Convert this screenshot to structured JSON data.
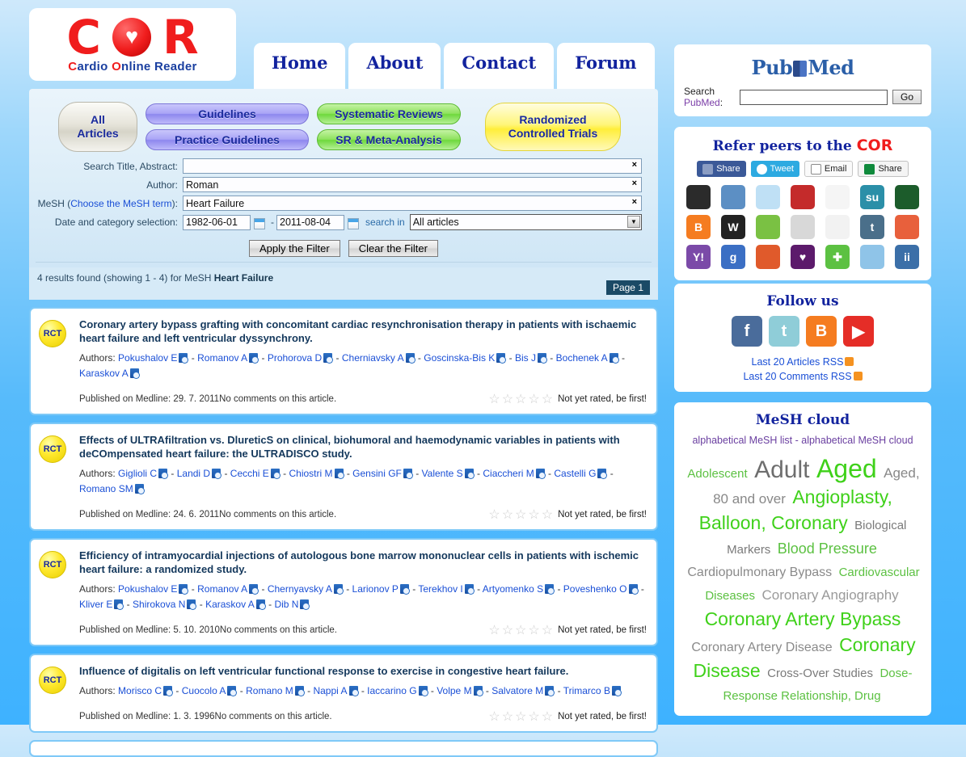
{
  "site": {
    "logo_c": "C",
    "logo_heart": "♥",
    "logo_r": "R",
    "tagline_pre": "C",
    "tagline": "ardio ",
    "tagline_o": "O",
    "tagline_2": "nline Reader"
  },
  "nav": {
    "tabs": [
      {
        "label": "Home",
        "active": true
      },
      {
        "label": "About",
        "active": false
      },
      {
        "label": "Contact",
        "active": false
      },
      {
        "label": "Forum",
        "active": false
      }
    ]
  },
  "categories": {
    "all_articles": "All\nArticles",
    "all_line1": "All",
    "all_line2": "Articles",
    "guidelines": "Guidelines",
    "practice_guidelines": "Practice Guidelines",
    "systematic_reviews": "Systematic Reviews",
    "sr_meta": "SR & Meta-Analysis",
    "rct_line1": "Randomized",
    "rct_line2": "Controlled Trials"
  },
  "filter": {
    "label_title": "Search Title, Abstract:",
    "value_title": "",
    "label_author": "Author:",
    "value_author": "Roman",
    "label_mesh_pre": "MeSH (",
    "label_mesh_link": "Choose the MeSH term",
    "label_mesh_post": "):",
    "value_mesh": "Heart Failure",
    "label_date": "Date and category selection:",
    "date_from": "1982-06-01",
    "date_to": "2011-08-04",
    "dash": "-",
    "search_in_label": "search in",
    "category_selected": "All articles",
    "apply_button": "Apply the Filter",
    "clear_button": "Clear the Filter",
    "clear_x": "×"
  },
  "results": {
    "summary_pre": "4 results found (showing 1 - 4) for MeSH ",
    "summary_term": "Heart Failure",
    "page_badge": "Page 1"
  },
  "articles": [
    {
      "badge": "RCT",
      "title": "Coronary artery bypass grafting with concomitant cardiac resynchronisation therapy in patients with ischaemic heart failure and left ventricular dyssynchrony.",
      "authors_label": "Authors:",
      "authors": [
        "Pokushalov E",
        "Romanov A",
        "Prohorova D",
        "Cherniavsky A",
        "Goscinska-Bis K",
        "Bis J",
        "Bochenek A",
        "Karaskov A"
      ],
      "published": "Published on Medline: 29. 7. 2011",
      "comments": "No comments on this article.",
      "rating_text": "Not yet rated, be first!",
      "stars": 0
    },
    {
      "badge": "RCT",
      "title": "Effects of ULTRAfiltration vs. DlureticS on clinical, biohumoral and haemodynamic variables in patients with deCOmpensated heart failure: the ULTRADISCO study.",
      "authors_label": "Authors:",
      "authors": [
        "Giglioli C",
        "Landi D",
        "Cecchi E",
        "Chiostri M",
        "Gensini GF",
        "Valente S",
        "Ciaccheri M",
        "Castelli G",
        "Romano SM"
      ],
      "published": "Published on Medline: 24. 6. 2011",
      "comments": "No comments on this article.",
      "rating_text": "Not yet rated, be first!",
      "stars": 0
    },
    {
      "badge": "RCT",
      "title": "Efficiency of intramyocardial injections of autologous bone marrow mononuclear cells in patients with ischemic heart failure: a randomized study.",
      "authors_label": "Authors:",
      "authors": [
        "Pokushalov E",
        "Romanov A",
        "Chernyavsky A",
        "Larionov P",
        "Terekhov I",
        "Artyomenko S",
        "Poveshenko O",
        "Kliver E",
        "Shirokova N",
        "Karaskov A",
        "Dib N"
      ],
      "published": "Published on Medline: 5. 10. 2010",
      "comments": "No comments on this article.",
      "rating_text": "Not yet rated, be first!",
      "stars": 0
    },
    {
      "badge": "RCT",
      "title": "Influence of digitalis on left ventricular functional response to exercise in congestive heart failure.",
      "authors_label": "Authors:",
      "authors": [
        "Morisco C",
        "Cuocolo A",
        "Romano M",
        "Nappi A",
        "Iaccarino G",
        "Volpe M",
        "Salvatore M",
        "Trimarco B"
      ],
      "published": "Published on Medline: 1. 3. 1996",
      "comments": "No comments on this article.",
      "rating_text": "Not yet rated, be first!",
      "stars": 0
    }
  ],
  "pubmed": {
    "logo_pub": "Pub",
    "logo_med": "Med",
    "search_label_pre": "Search ",
    "search_label_hl": "PubMed",
    "search_label_post": ":",
    "value": "",
    "go_button": "Go"
  },
  "refer": {
    "title_pre": "Refer peers to the ",
    "title_cor": "COR",
    "buttons": [
      {
        "label": "Share",
        "icon": "facebook-icon"
      },
      {
        "label": "Tweet",
        "icon": "twitter-icon"
      },
      {
        "label": "Email",
        "icon": "envelope-icon"
      },
      {
        "label": "Share",
        "icon": "share-icon"
      }
    ],
    "bookmarks": [
      {
        "name": "delicious-icon",
        "glyph": "",
        "color": "#2b2b2b"
      },
      {
        "name": "diigo-icon",
        "glyph": "",
        "color": "#5c8fc4"
      },
      {
        "name": "reddit-icon",
        "glyph": "",
        "color": "#bfe0f5"
      },
      {
        "name": "mixx-icon",
        "glyph": "",
        "color": "#c42b2b"
      },
      {
        "name": "technorati-icon",
        "glyph": "",
        "color": "#f5f5f5"
      },
      {
        "name": "stumbleupon-icon",
        "glyph": "su",
        "color": "#2b8fa8"
      },
      {
        "name": "newsvine-icon",
        "glyph": "",
        "color": "#1c5c2b"
      },
      {
        "name": "blogger-icon",
        "glyph": "B",
        "color": "#f57c20"
      },
      {
        "name": "wordpress-icon",
        "glyph": "W",
        "color": "#222222"
      },
      {
        "name": "evernote-icon",
        "glyph": "",
        "color": "#7ac143"
      },
      {
        "name": "pencil-icon",
        "glyph": "",
        "color": "#d8d8d8"
      },
      {
        "name": "friendfeed-icon",
        "glyph": "",
        "color": "#f2f2f2"
      },
      {
        "name": "tumblr-icon",
        "glyph": "t",
        "color": "#4a6f8a"
      },
      {
        "name": "squidoo-icon",
        "glyph": "",
        "color": "#e8603c"
      },
      {
        "name": "yahoo-icon",
        "glyph": "Y!",
        "color": "#7b4aa8"
      },
      {
        "name": "google-icon",
        "glyph": "g",
        "color": "#3b6fc4"
      },
      {
        "name": "rss-icon",
        "glyph": "",
        "color": "#e05a2b"
      },
      {
        "name": "heart-icon",
        "glyph": "♥",
        "color": "#5c1a6b"
      },
      {
        "name": "plus-icon",
        "glyph": "✚",
        "color": "#5cc142"
      },
      {
        "name": "award-icon",
        "glyph": "",
        "color": "#8fc4e8"
      },
      {
        "name": "hi5-icon",
        "glyph": "ii",
        "color": "#3b6fa8"
      }
    ]
  },
  "follow": {
    "title": "Follow us",
    "icons": [
      {
        "name": "facebook-icon",
        "glyph": "f",
        "color": "#4a6c9b"
      },
      {
        "name": "twitter-icon",
        "glyph": "t",
        "color": "#8fcdd8"
      },
      {
        "name": "blogger-icon",
        "glyph": "B",
        "color": "#f57c20"
      },
      {
        "name": "youtube-icon",
        "glyph": "▶",
        "color": "#e52d27"
      }
    ],
    "rss_articles": "Last 20 Articles RSS",
    "rss_comments": "Last 20 Comments RSS"
  },
  "mesh_cloud": {
    "title": "MeSH cloud",
    "link_list": "alphabetical MeSH list",
    "link_sep": " - ",
    "link_cloud": "alphabetical MeSH cloud",
    "terms": [
      {
        "text": "Adolescent",
        "size": 15,
        "color": "#5cc142"
      },
      {
        "text": "Adult",
        "size": 30,
        "color": "#6e6e6e"
      },
      {
        "text": "Aged",
        "size": 32,
        "color": "#3fd11a"
      },
      {
        "text": "Aged, 80 and over",
        "size": 17,
        "color": "#888888"
      },
      {
        "text": "Angioplasty, Balloon, Coronary",
        "size": 23,
        "color": "#3fd11a"
      },
      {
        "text": "Biological Markers",
        "size": 15,
        "color": "#7a7a7a"
      },
      {
        "text": "Blood Pressure",
        "size": 18,
        "color": "#5cc142"
      },
      {
        "text": "Cardiopulmonary Bypass",
        "size": 16,
        "color": "#8a8a8a"
      },
      {
        "text": "Cardiovascular Diseases",
        "size": 15,
        "color": "#5cc142"
      },
      {
        "text": "Coronary Angiography",
        "size": 17,
        "color": "#9a9a9a"
      },
      {
        "text": "Coronary Artery Bypass",
        "size": 23,
        "color": "#3fd11a"
      },
      {
        "text": "Coronary Artery Disease",
        "size": 16,
        "color": "#8a8a8a"
      },
      {
        "text": "Coronary Disease",
        "size": 23,
        "color": "#3fd11a"
      },
      {
        "text": "Cross-Over Studies",
        "size": 15,
        "color": "#7a7a7a"
      },
      {
        "text": "Dose-Response Relationship, Drug",
        "size": 15,
        "color": "#5cc142"
      }
    ]
  }
}
